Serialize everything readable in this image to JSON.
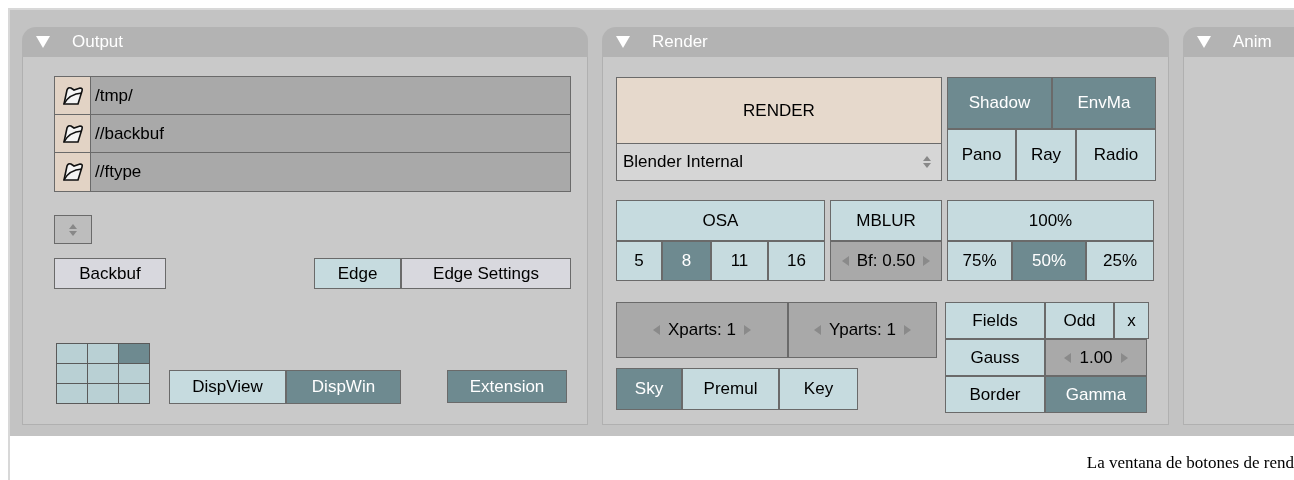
{
  "output_panel": {
    "title": "Output",
    "expanded": true,
    "paths": [
      {
        "text": "/tmp/"
      },
      {
        "text": "//backbuf"
      },
      {
        "text": "//ftype"
      }
    ],
    "backbuf": {
      "label": "Backbuf",
      "kind": "push"
    },
    "edge": [
      {
        "label": "Edge",
        "kind": "toggle",
        "on": false
      },
      {
        "label": "Edge Settings",
        "kind": "push"
      }
    ],
    "layout_grid": [
      {
        "selected": false
      },
      {
        "selected": false
      },
      {
        "selected": true
      },
      {
        "selected": false
      },
      {
        "selected": false
      },
      {
        "selected": false
      },
      {
        "selected": false
      },
      {
        "selected": false
      },
      {
        "selected": false
      }
    ],
    "display": [
      {
        "label": "DispView",
        "selected": false
      },
      {
        "label": "DispWin",
        "selected": true
      }
    ],
    "extension": {
      "label": "Extension",
      "kind": "toggle",
      "on": true
    }
  },
  "render_panel": {
    "title": "Render",
    "expanded": true,
    "render_button": {
      "label": "RENDER"
    },
    "engine": {
      "value": "Blender Internal"
    },
    "shading": [
      [
        {
          "label": "Shadow",
          "kind": "toggle",
          "on": true
        },
        {
          "label": "EnvMa",
          "kind": "toggle",
          "on": true
        }
      ],
      [
        {
          "label": "Pano",
          "kind": "toggle",
          "on": false
        },
        {
          "label": "Ray",
          "kind": "toggle",
          "on": false
        },
        {
          "label": "Radio",
          "kind": "toggle",
          "on": false
        }
      ]
    ],
    "osa": {
      "toggle": {
        "label": "OSA",
        "kind": "toggle",
        "on": false
      },
      "levels": [
        {
          "label": "5",
          "kind": "option",
          "selected": false
        },
        {
          "label": "8",
          "kind": "option",
          "selected": true
        },
        {
          "label": "11",
          "kind": "option",
          "selected": false
        },
        {
          "label": "16",
          "kind": "option",
          "selected": false
        }
      ]
    },
    "mblur": {
      "toggle": {
        "label": "MBLUR",
        "kind": "toggle",
        "on": false
      },
      "levels": [
        {
          "label": "Bf: 0.50",
          "kind": "number"
        }
      ]
    },
    "size": {
      "toggle": {
        "label": "100%",
        "kind": "toggle",
        "on": false
      },
      "levels": [
        {
          "label": "75%",
          "kind": "option",
          "selected": false
        },
        {
          "label": "50%",
          "kind": "option",
          "selected": true
        },
        {
          "label": "25%",
          "kind": "option",
          "selected": false
        }
      ]
    },
    "parts": [
      {
        "label": "Xparts: 1",
        "kind": "number"
      },
      {
        "label": "Yparts: 1",
        "kind": "number"
      }
    ],
    "alpha": [
      {
        "label": "Sky",
        "kind": "option",
        "selected": true
      },
      {
        "label": "Premul",
        "kind": "option",
        "selected": false
      },
      {
        "label": "Key",
        "kind": "option",
        "selected": false
      }
    ],
    "fields": [
      [
        {
          "label": "Fields",
          "kind": "toggle",
          "on": false
        },
        {
          "label": "Odd",
          "kind": "toggle",
          "on": false
        },
        {
          "label": "x",
          "kind": "toggle",
          "on": false
        }
      ],
      [
        {
          "label": "Gauss",
          "kind": "toggle",
          "on": false
        },
        {
          "label": "1.00",
          "kind": "number"
        }
      ],
      [
        {
          "label": "Border",
          "kind": "toggle",
          "on": false
        },
        {
          "label": "Gamma",
          "kind": "toggle",
          "on": true
        }
      ]
    ]
  },
  "anim_panel": {
    "title": "Anim",
    "expanded": true
  },
  "caption": "La ventana de botones de rend"
}
